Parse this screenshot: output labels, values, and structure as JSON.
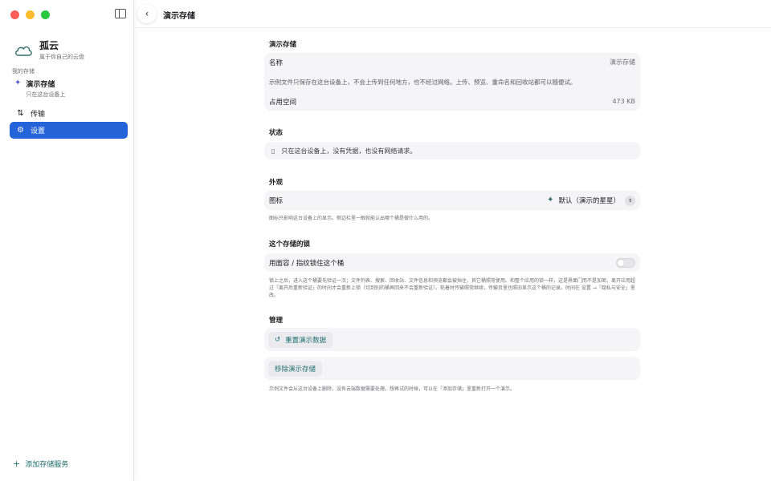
{
  "app": {
    "name": "孤云",
    "tagline": "属于你自己的云盘"
  },
  "sidebar": {
    "section_label": "我的存储",
    "storage": {
      "name": "演示存储",
      "sub": "只在这台设备上"
    },
    "nav": [
      {
        "label": "传输",
        "icon": "arrows-up-down-icon"
      },
      {
        "label": "设置",
        "icon": "gear-icon",
        "selected": true
      }
    ],
    "add_service": "添加存储服务"
  },
  "header": {
    "title": "演示存储"
  },
  "sections": {
    "storage": {
      "title": "演示存储",
      "name_label": "名称",
      "name_value": "演示存储",
      "description": "示例文件只保存在这台设备上，不会上传到任何地方，也不经过网络。上传、预览、重命名和回收站都可以随便试。",
      "space_label": "占用空间",
      "space_value": "473 KB"
    },
    "status": {
      "title": "状态",
      "text": "只在这台设备上，没有凭据，也没有网络请求。"
    },
    "appearance": {
      "title": "外观",
      "icon_label": "图标",
      "icon_value": "默认（演示的星星）",
      "note": "图标只影响这台设备上的显示。侧边栏里一眼就能认出哪个桶是做什么用的。"
    },
    "lock": {
      "title": "这个存储的锁",
      "toggle_label": "用面容 / 指纹锁住这个桶",
      "toggle_on": false,
      "note": "锁上之后，进入这个桶要先验证一次；文件列表、搜索、回收站、文件信息和预览都会被挡住，其它桶照常使用。和整个应用的锁一样，这是界面门而不是加密。离开应用超过「离开后重新验证」的时间才会重新上锁（切到别的桶再回来不会重新验证）。轮着时传输照常继续，传输页里也照旧显示这个桶的记录。时间在 设置 →「隐私与安全」里改。"
    },
    "manage": {
      "title": "管理",
      "reset_label": "重置演示数据",
      "remove_label": "移除演示存储",
      "note": "示例文件会从这台设备上删除，没有云端数据需要处理。想再试的时候，可以在「添加存储」里重新打开一个演示。"
    }
  }
}
